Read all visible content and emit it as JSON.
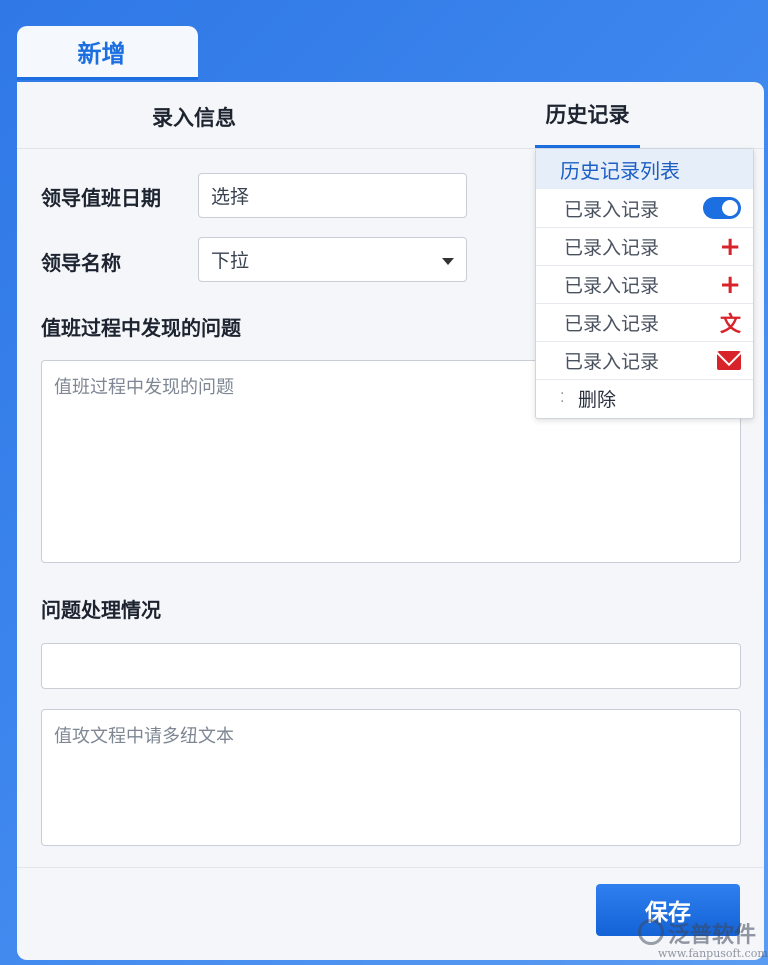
{
  "top_tab": {
    "label": "新增"
  },
  "tabs": {
    "entry": "录入信息",
    "history": "历史记录"
  },
  "form": {
    "date": {
      "label": "领导值班日期",
      "value": "选择"
    },
    "name": {
      "label": "领导名称",
      "value": "下拉"
    },
    "problems": {
      "label": "值班过程中发现的问题",
      "placeholder": "值班过程中发现的问题"
    },
    "handling": {
      "label": "问题处理情况",
      "value": "",
      "textarea_placeholder": "值攻文程中请多纽文本"
    }
  },
  "history": {
    "title": "历史记录列表",
    "items": [
      {
        "label": "已录入记录",
        "icon": "toggle-icon"
      },
      {
        "label": "已录入记录",
        "icon": "plus-icon"
      },
      {
        "label": "已录入记录",
        "icon": "plus-icon"
      },
      {
        "label": "已录入记录",
        "icon": "text-icon",
        "glyph": "文"
      },
      {
        "label": "已录入记录",
        "icon": "mail-icon"
      }
    ],
    "delete_label": "删除"
  },
  "save_label": "保存",
  "watermark": {
    "name": "泛普软件",
    "url": "www.fanpusoft.com"
  },
  "colors": {
    "accent": "#1c6fe0",
    "danger": "#d8232a",
    "background": "#3d86ee"
  }
}
